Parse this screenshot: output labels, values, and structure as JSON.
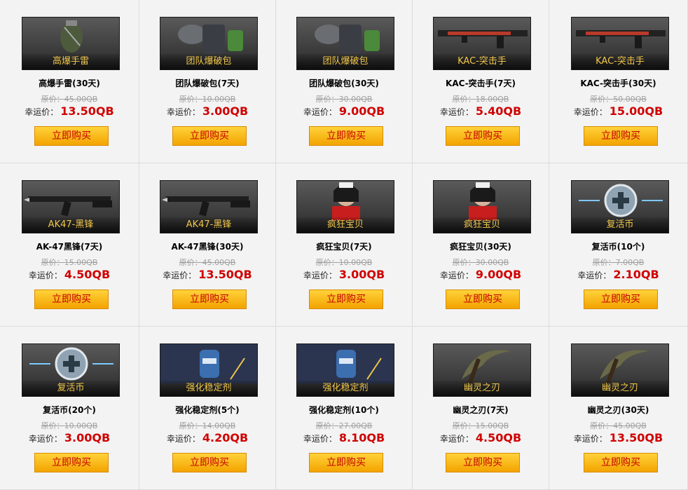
{
  "labels": {
    "original_prefix": "原价：",
    "lucky_prefix": "幸运价：",
    "buy": "立即购买"
  },
  "colors": {
    "price": "#d00000",
    "thumb_label": "#f0c64a",
    "button_top": "#ffd23a",
    "button_bottom": "#f3a300"
  },
  "items": [
    {
      "thumb_label": "高爆手雷",
      "name": "高爆手雷(30天)",
      "original": "45.00QB",
      "lucky": "13.50QB",
      "icon": "grenade-icon"
    },
    {
      "thumb_label": "团队爆破包",
      "name": "团队爆破包(7天)",
      "original": "10.00QB",
      "lucky": "3.00QB",
      "icon": "demolition-pack-icon"
    },
    {
      "thumb_label": "团队爆破包",
      "name": "团队爆破包(30天)",
      "original": "30.00QB",
      "lucky": "9.00QB",
      "icon": "demolition-pack-icon"
    },
    {
      "thumb_label": "KAC-突击手",
      "name": "KAC-突击手(7天)",
      "original": "18.00QB",
      "lucky": "5.40QB",
      "icon": "rifle-icon"
    },
    {
      "thumb_label": "KAC-突击手",
      "name": "KAC-突击手(30天)",
      "original": "50.00QB",
      "lucky": "15.00QB",
      "icon": "rifle-icon"
    },
    {
      "thumb_label": "AK47-黑锋",
      "name": "AK-47黑锋(7天)",
      "original": "15.00QB",
      "lucky": "4.50QB",
      "icon": "ak47-icon"
    },
    {
      "thumb_label": "AK47-黑锋",
      "name": "AK-47黑锋(30天)",
      "original": "45.00QB",
      "lucky": "13.50QB",
      "icon": "ak47-icon"
    },
    {
      "thumb_label": "疯狂宝贝",
      "name": "疯狂宝贝(7天)",
      "original": "10.00QB",
      "lucky": "3.00QB",
      "icon": "character-icon"
    },
    {
      "thumb_label": "疯狂宝贝",
      "name": "疯狂宝贝(30天)",
      "original": "30.00QB",
      "lucky": "9.00QB",
      "icon": "character-icon"
    },
    {
      "thumb_label": "复活币",
      "name": "复活币(10个)",
      "original": "7.00QB",
      "lucky": "2.10QB",
      "icon": "revive-coin-icon"
    },
    {
      "thumb_label": "复活币",
      "name": "复活币(20个)",
      "original": "10.00QB",
      "lucky": "3.00QB",
      "icon": "revive-coin-icon"
    },
    {
      "thumb_label": "强化稳定剂",
      "name": "强化稳定剂(5个)",
      "original": "14.00QB",
      "lucky": "4.20QB",
      "icon": "stabilizer-icon"
    },
    {
      "thumb_label": "强化稳定剂",
      "name": "强化稳定剂(10个)",
      "original": "27.00QB",
      "lucky": "8.10QB",
      "icon": "stabilizer-icon"
    },
    {
      "thumb_label": "幽灵之刃",
      "name": "幽灵之刃(7天)",
      "original": "15.00QB",
      "lucky": "4.50QB",
      "icon": "blade-icon"
    },
    {
      "thumb_label": "幽灵之刃",
      "name": "幽灵之刃(30天)",
      "original": "45.00QB",
      "lucky": "13.50QB",
      "icon": "blade-icon"
    }
  ]
}
